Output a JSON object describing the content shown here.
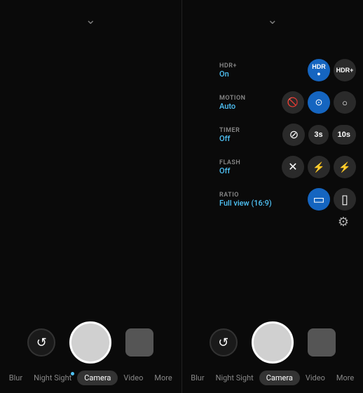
{
  "left_panel": {
    "chevron": "⌄",
    "controls": {
      "rotate_icon": "↺",
      "shutter_label": "shutter",
      "thumbnail_label": "thumbnail"
    },
    "tabs": [
      {
        "id": "blur",
        "label": "Blur",
        "active": false,
        "dot": false
      },
      {
        "id": "night-sight",
        "label": "Night Sight",
        "active": false,
        "dot": true
      },
      {
        "id": "camera",
        "label": "Camera",
        "active": true,
        "dot": false
      },
      {
        "id": "video",
        "label": "Video",
        "active": false,
        "dot": false
      },
      {
        "id": "more",
        "label": "More",
        "active": false,
        "dot": false
      }
    ]
  },
  "right_panel": {
    "settings": [
      {
        "id": "hdr",
        "category": "HDR+",
        "value": "On",
        "options": [
          {
            "label": "HDR•",
            "icon": "hdr_active",
            "active": true
          },
          {
            "label": "HDR+",
            "icon": "hdr_plus",
            "active": false
          }
        ]
      },
      {
        "id": "motion",
        "category": "MOTION",
        "value": "Auto",
        "options": [
          {
            "label": "🚫",
            "icon": "motion_off",
            "active": false
          },
          {
            "label": "⊙",
            "icon": "motion_auto",
            "active": true
          },
          {
            "label": "○",
            "icon": "motion_on",
            "active": false
          }
        ]
      },
      {
        "id": "timer",
        "category": "TIMER",
        "value": "Off",
        "options": [
          {
            "label": "⊘",
            "icon": "timer_off",
            "active": false
          },
          {
            "label": "3s",
            "icon": "timer_3s",
            "active": false
          },
          {
            "label": "10s",
            "icon": "timer_10s",
            "active": false
          }
        ]
      },
      {
        "id": "flash",
        "category": "FLASH",
        "value": "Off",
        "options": [
          {
            "label": "✗",
            "icon": "flash_off",
            "active": false
          },
          {
            "label": "⚡",
            "icon": "flash_auto",
            "active": false
          },
          {
            "label": "⚡",
            "icon": "flash_on",
            "active": false
          }
        ]
      },
      {
        "id": "ratio",
        "category": "RATIO",
        "value": "Full view (16:9)",
        "options": [
          {
            "label": "▭",
            "icon": "ratio_full",
            "active": true
          },
          {
            "label": "▯",
            "icon": "ratio_square",
            "active": false
          }
        ]
      }
    ],
    "gear_icon": "⚙",
    "tabs": [
      {
        "id": "blur",
        "label": "Blur",
        "active": false,
        "dot": false
      },
      {
        "id": "night-sight",
        "label": "Night Sight",
        "active": false,
        "dot": false
      },
      {
        "id": "camera",
        "label": "Camera",
        "active": true,
        "dot": false
      },
      {
        "id": "video",
        "label": "Video",
        "active": false,
        "dot": false
      },
      {
        "id": "more",
        "label": "More",
        "active": false,
        "dot": false
      }
    ]
  },
  "colors": {
    "active_blue": "#1565c0",
    "accent_blue": "#4fc3f7",
    "bg_dark": "#0a0a0a",
    "btn_inactive": "#2a2a2a"
  }
}
